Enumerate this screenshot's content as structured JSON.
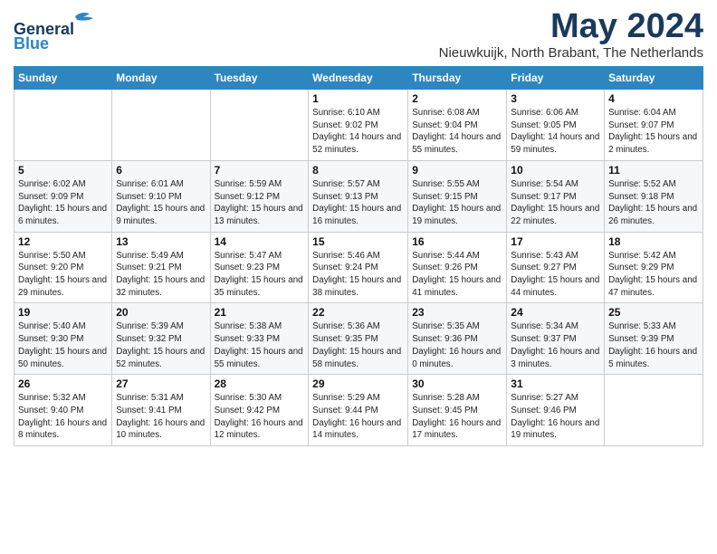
{
  "logo": {
    "line1": "General",
    "line2": "Blue"
  },
  "title": "May 2024",
  "location": "Nieuwkuijk, North Brabant, The Netherlands",
  "headers": [
    "Sunday",
    "Monday",
    "Tuesday",
    "Wednesday",
    "Thursday",
    "Friday",
    "Saturday"
  ],
  "weeks": [
    [
      {
        "day": "",
        "info": ""
      },
      {
        "day": "",
        "info": ""
      },
      {
        "day": "",
        "info": ""
      },
      {
        "day": "1",
        "info": "Sunrise: 6:10 AM\nSunset: 9:02 PM\nDaylight: 14 hours and 52 minutes."
      },
      {
        "day": "2",
        "info": "Sunrise: 6:08 AM\nSunset: 9:04 PM\nDaylight: 14 hours and 55 minutes."
      },
      {
        "day": "3",
        "info": "Sunrise: 6:06 AM\nSunset: 9:05 PM\nDaylight: 14 hours and 59 minutes."
      },
      {
        "day": "4",
        "info": "Sunrise: 6:04 AM\nSunset: 9:07 PM\nDaylight: 15 hours and 2 minutes."
      }
    ],
    [
      {
        "day": "5",
        "info": "Sunrise: 6:02 AM\nSunset: 9:09 PM\nDaylight: 15 hours and 6 minutes."
      },
      {
        "day": "6",
        "info": "Sunrise: 6:01 AM\nSunset: 9:10 PM\nDaylight: 15 hours and 9 minutes."
      },
      {
        "day": "7",
        "info": "Sunrise: 5:59 AM\nSunset: 9:12 PM\nDaylight: 15 hours and 13 minutes."
      },
      {
        "day": "8",
        "info": "Sunrise: 5:57 AM\nSunset: 9:13 PM\nDaylight: 15 hours and 16 minutes."
      },
      {
        "day": "9",
        "info": "Sunrise: 5:55 AM\nSunset: 9:15 PM\nDaylight: 15 hours and 19 minutes."
      },
      {
        "day": "10",
        "info": "Sunrise: 5:54 AM\nSunset: 9:17 PM\nDaylight: 15 hours and 22 minutes."
      },
      {
        "day": "11",
        "info": "Sunrise: 5:52 AM\nSunset: 9:18 PM\nDaylight: 15 hours and 26 minutes."
      }
    ],
    [
      {
        "day": "12",
        "info": "Sunrise: 5:50 AM\nSunset: 9:20 PM\nDaylight: 15 hours and 29 minutes."
      },
      {
        "day": "13",
        "info": "Sunrise: 5:49 AM\nSunset: 9:21 PM\nDaylight: 15 hours and 32 minutes."
      },
      {
        "day": "14",
        "info": "Sunrise: 5:47 AM\nSunset: 9:23 PM\nDaylight: 15 hours and 35 minutes."
      },
      {
        "day": "15",
        "info": "Sunrise: 5:46 AM\nSunset: 9:24 PM\nDaylight: 15 hours and 38 minutes."
      },
      {
        "day": "16",
        "info": "Sunrise: 5:44 AM\nSunset: 9:26 PM\nDaylight: 15 hours and 41 minutes."
      },
      {
        "day": "17",
        "info": "Sunrise: 5:43 AM\nSunset: 9:27 PM\nDaylight: 15 hours and 44 minutes."
      },
      {
        "day": "18",
        "info": "Sunrise: 5:42 AM\nSunset: 9:29 PM\nDaylight: 15 hours and 47 minutes."
      }
    ],
    [
      {
        "day": "19",
        "info": "Sunrise: 5:40 AM\nSunset: 9:30 PM\nDaylight: 15 hours and 50 minutes."
      },
      {
        "day": "20",
        "info": "Sunrise: 5:39 AM\nSunset: 9:32 PM\nDaylight: 15 hours and 52 minutes."
      },
      {
        "day": "21",
        "info": "Sunrise: 5:38 AM\nSunset: 9:33 PM\nDaylight: 15 hours and 55 minutes."
      },
      {
        "day": "22",
        "info": "Sunrise: 5:36 AM\nSunset: 9:35 PM\nDaylight: 15 hours and 58 minutes."
      },
      {
        "day": "23",
        "info": "Sunrise: 5:35 AM\nSunset: 9:36 PM\nDaylight: 16 hours and 0 minutes."
      },
      {
        "day": "24",
        "info": "Sunrise: 5:34 AM\nSunset: 9:37 PM\nDaylight: 16 hours and 3 minutes."
      },
      {
        "day": "25",
        "info": "Sunrise: 5:33 AM\nSunset: 9:39 PM\nDaylight: 16 hours and 5 minutes."
      }
    ],
    [
      {
        "day": "26",
        "info": "Sunrise: 5:32 AM\nSunset: 9:40 PM\nDaylight: 16 hours and 8 minutes."
      },
      {
        "day": "27",
        "info": "Sunrise: 5:31 AM\nSunset: 9:41 PM\nDaylight: 16 hours and 10 minutes."
      },
      {
        "day": "28",
        "info": "Sunrise: 5:30 AM\nSunset: 9:42 PM\nDaylight: 16 hours and 12 minutes."
      },
      {
        "day": "29",
        "info": "Sunrise: 5:29 AM\nSunset: 9:44 PM\nDaylight: 16 hours and 14 minutes."
      },
      {
        "day": "30",
        "info": "Sunrise: 5:28 AM\nSunset: 9:45 PM\nDaylight: 16 hours and 17 minutes."
      },
      {
        "day": "31",
        "info": "Sunrise: 5:27 AM\nSunset: 9:46 PM\nDaylight: 16 hours and 19 minutes."
      },
      {
        "day": "",
        "info": ""
      }
    ]
  ]
}
